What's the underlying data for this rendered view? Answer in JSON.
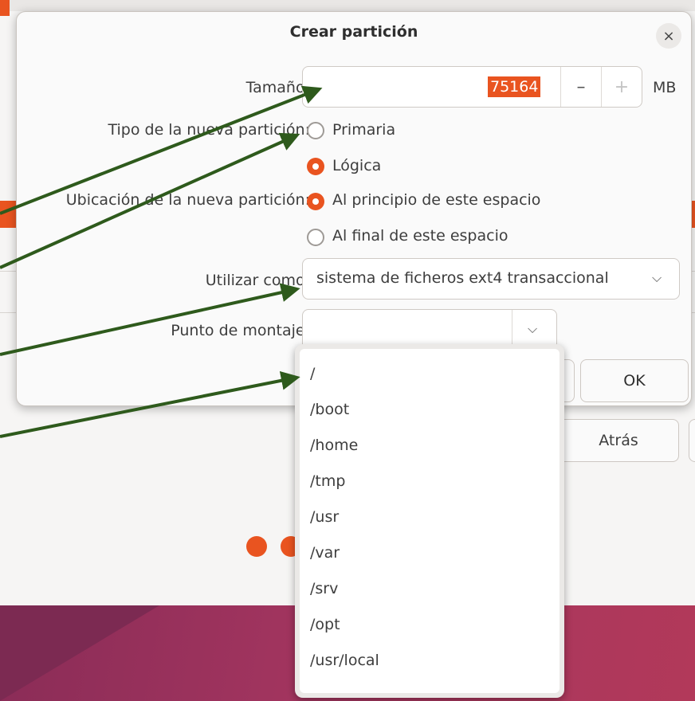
{
  "dialog": {
    "title": "Crear partición",
    "close_symbol": "×",
    "size": {
      "label": "Tamaño:",
      "value": "75164",
      "minus": "–",
      "plus": "+",
      "unit": "MB"
    },
    "partition_type": {
      "label": "Tipo de la nueva partición:",
      "options": [
        {
          "label": "Primaria",
          "checked": false
        },
        {
          "label": "Lógica",
          "checked": true
        }
      ]
    },
    "location": {
      "label": "Ubicación de la nueva partición:",
      "options": [
        {
          "label": "Al principio de este espacio",
          "checked": true
        },
        {
          "label": "Al final de este espacio",
          "checked": false
        }
      ]
    },
    "use_as": {
      "label": "Utilizar como:",
      "value": "sistema de ficheros ext4 transaccional",
      "chevron": "⌵"
    },
    "mount_point": {
      "label": "Punto de montaje:",
      "value": "",
      "chevron": "⌵"
    },
    "ok_label": "OK"
  },
  "mount_options": [
    "/",
    "/boot",
    "/home",
    "/tmp",
    "/usr",
    "/var",
    "/srv",
    "/opt",
    "/usr/local"
  ],
  "background": {
    "back_label": "Atrás"
  },
  "colors": {
    "accent": "#e95420",
    "arrow": "#2e5a1c",
    "wallpaper": "#a3355f"
  },
  "icons": [
    "close-icon",
    "minus-icon",
    "plus-icon",
    "chevron-down-icon",
    "radio-icon"
  ]
}
